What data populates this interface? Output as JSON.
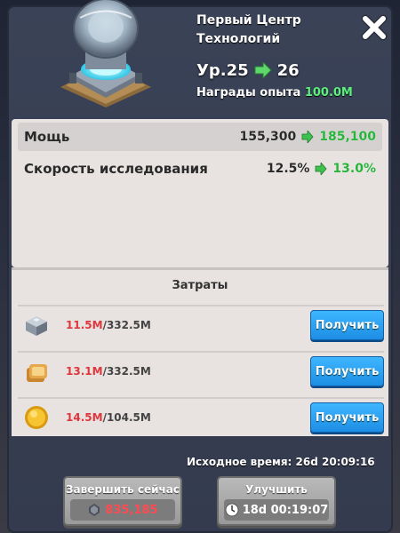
{
  "header": {
    "title_line1": "Первый Центр",
    "title_line2": "Технологий",
    "level_prefix": "Ур.25",
    "level_next": "26",
    "xp_label": "Награды опыта",
    "xp_value": "100.0M"
  },
  "stats": [
    {
      "label": "Мощь",
      "old": "155,300",
      "new": "185,100"
    },
    {
      "label": "Скорость исследования",
      "old": "12.5%",
      "new": "13.0%"
    }
  ],
  "costs": {
    "title": "Затраты",
    "items": [
      {
        "icon": "iron-ingot-icon",
        "have": "11.5M",
        "need": "/332.5M",
        "button": "Получить"
      },
      {
        "icon": "bread-icon",
        "have": "13.1M",
        "need": "/332.5M",
        "button": "Получить"
      },
      {
        "icon": "gold-coin-icon",
        "have": "14.5M",
        "need": "/104.5M",
        "button": "Получить"
      }
    ]
  },
  "original_time": "Исходное время: 26d 20:09:16",
  "buttons": {
    "finish_label": "Завершить сейчас",
    "finish_cost": "835,185",
    "upgrade_label": "Улучшить",
    "upgrade_time": "18d 00:19:07"
  },
  "colors": {
    "accent_green": "#5cf07c",
    "stat_new_green": "#28b43c",
    "deficit_red": "#e0353a",
    "button_blue": "#1d8ee5"
  }
}
